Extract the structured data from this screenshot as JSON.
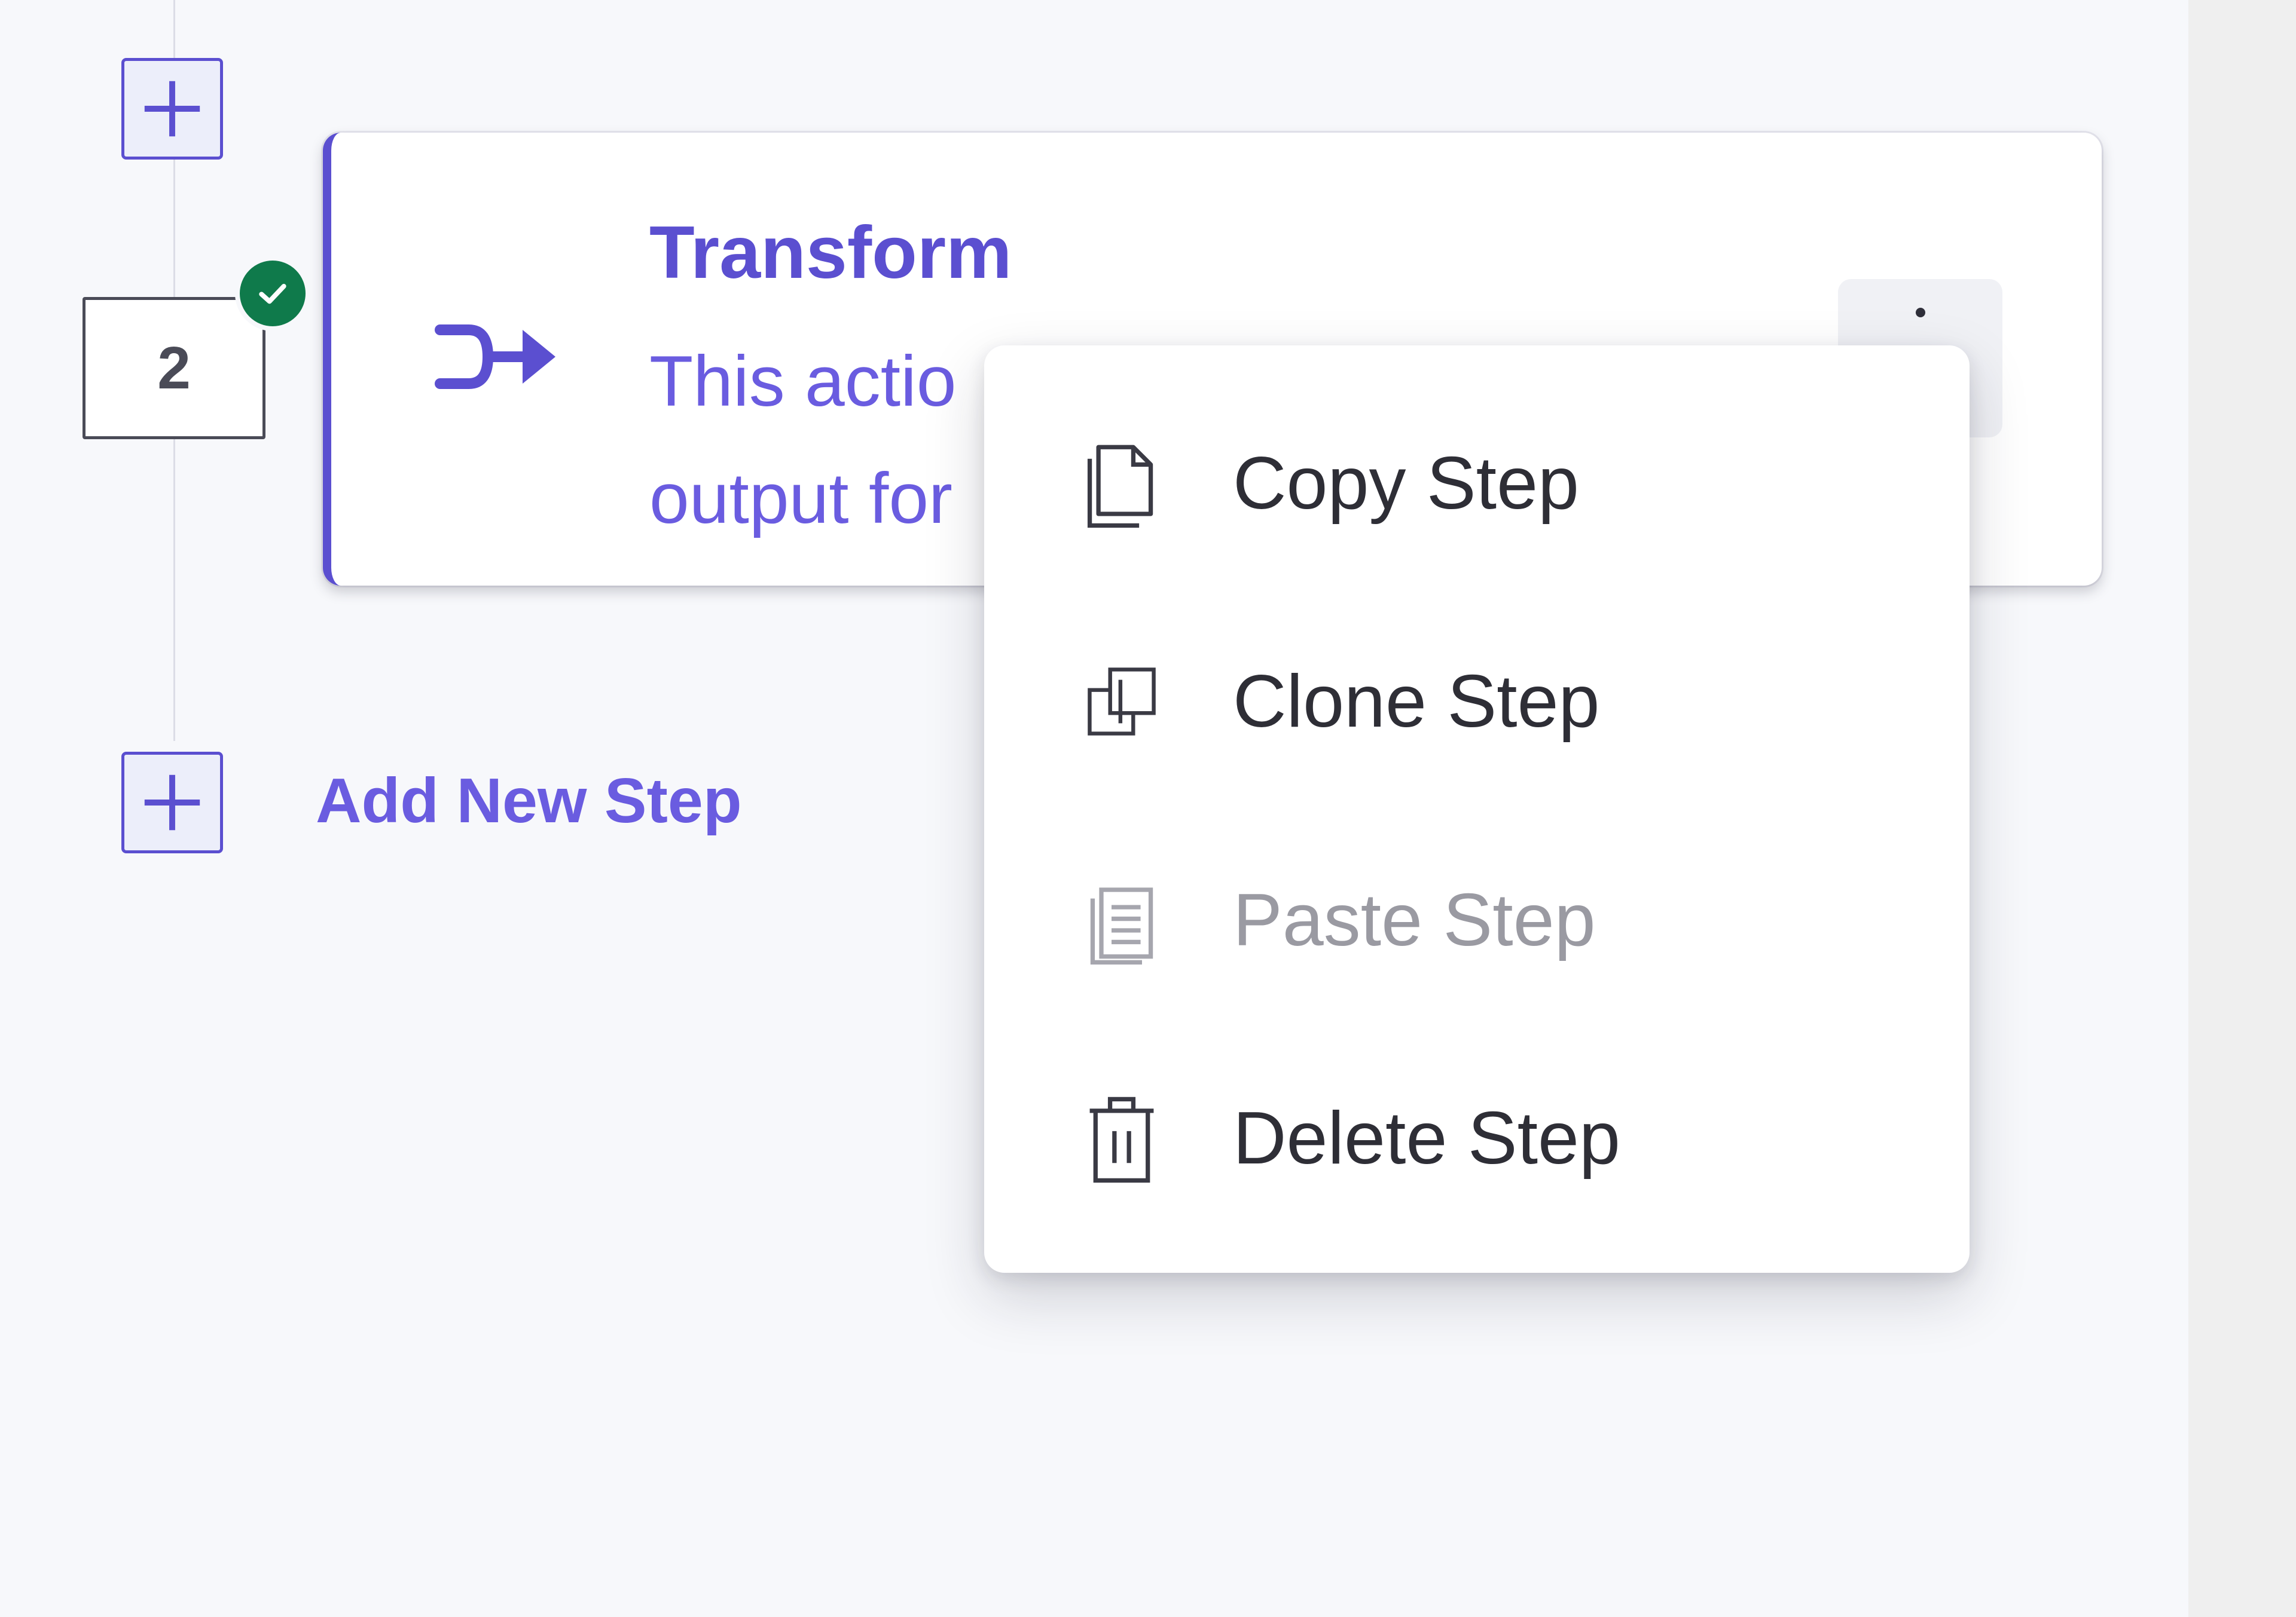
{
  "workflow": {
    "step": {
      "number": "2",
      "status": "completed",
      "title": "Transform",
      "description_line1": "This actio",
      "description_line2": "output for",
      "icon": "transform-arrow-icon"
    },
    "add_new_step_label": "Add New Step"
  },
  "context_menu": {
    "items": [
      {
        "label": "Copy Step",
        "icon": "copy-icon",
        "enabled": true
      },
      {
        "label": "Clone Step",
        "icon": "clone-icon",
        "enabled": true
      },
      {
        "label": "Paste Step",
        "icon": "paste-icon",
        "enabled": false
      },
      {
        "label": "Delete Step",
        "icon": "trash-icon",
        "enabled": true
      }
    ]
  },
  "colors": {
    "accent": "#5b4fd0",
    "success": "#0f7a4b",
    "text": "#2e2e36",
    "disabled_text": "#9a9aa2"
  }
}
